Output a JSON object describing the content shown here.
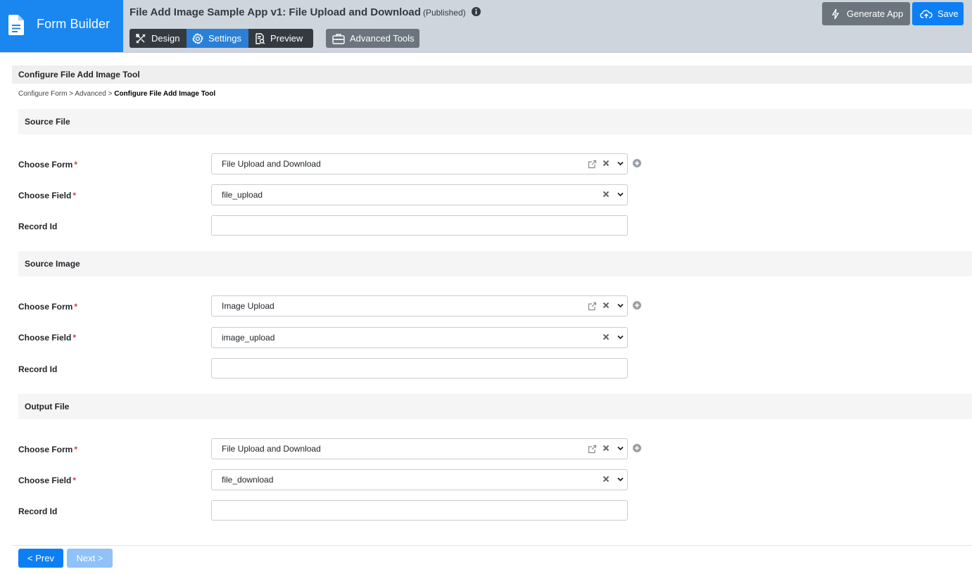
{
  "brand": {
    "name": "Form Builder",
    "icon": "document-icon"
  },
  "app": {
    "title": "File Add Image Sample App v1: File Upload and Download",
    "status": "(Published)"
  },
  "tabs": [
    {
      "label": "Design",
      "icon": "design-tools-icon",
      "active": false
    },
    {
      "label": "Settings",
      "icon": "gear-icon",
      "active": true
    },
    {
      "label": "Preview",
      "icon": "preview-icon",
      "active": false
    }
  ],
  "advanced_tools_label": "Advanced Tools",
  "actions": {
    "generate_label": "Generate App",
    "save_label": "Save"
  },
  "page": {
    "title": "Configure File Add Image Tool"
  },
  "breadcrumb": {
    "items": [
      "Configure Form",
      "Advanced"
    ],
    "separator": ">",
    "current": "Configure File Add Image Tool"
  },
  "labels": {
    "choose_form": "Choose Form",
    "choose_field": "Choose Field",
    "record_id": "Record Id",
    "required_mark": "*"
  },
  "sections": [
    {
      "title": "Source File",
      "form": "File Upload and Download",
      "field": "file_upload",
      "record_id": ""
    },
    {
      "title": "Source Image",
      "form": "Image Upload",
      "field": "image_upload",
      "record_id": ""
    },
    {
      "title": "Output File",
      "form": "File Upload and Download",
      "field": "file_download",
      "record_id": ""
    }
  ],
  "nav": {
    "prev_label": "< Prev",
    "next_label": "Next >",
    "next_disabled": true
  },
  "colors": {
    "brand": "#1a87f0",
    "primary": "#0d7ff5",
    "header_bg": "#cfd5dc",
    "active_tab": "#2b7fd4",
    "required": "#dc3545"
  }
}
